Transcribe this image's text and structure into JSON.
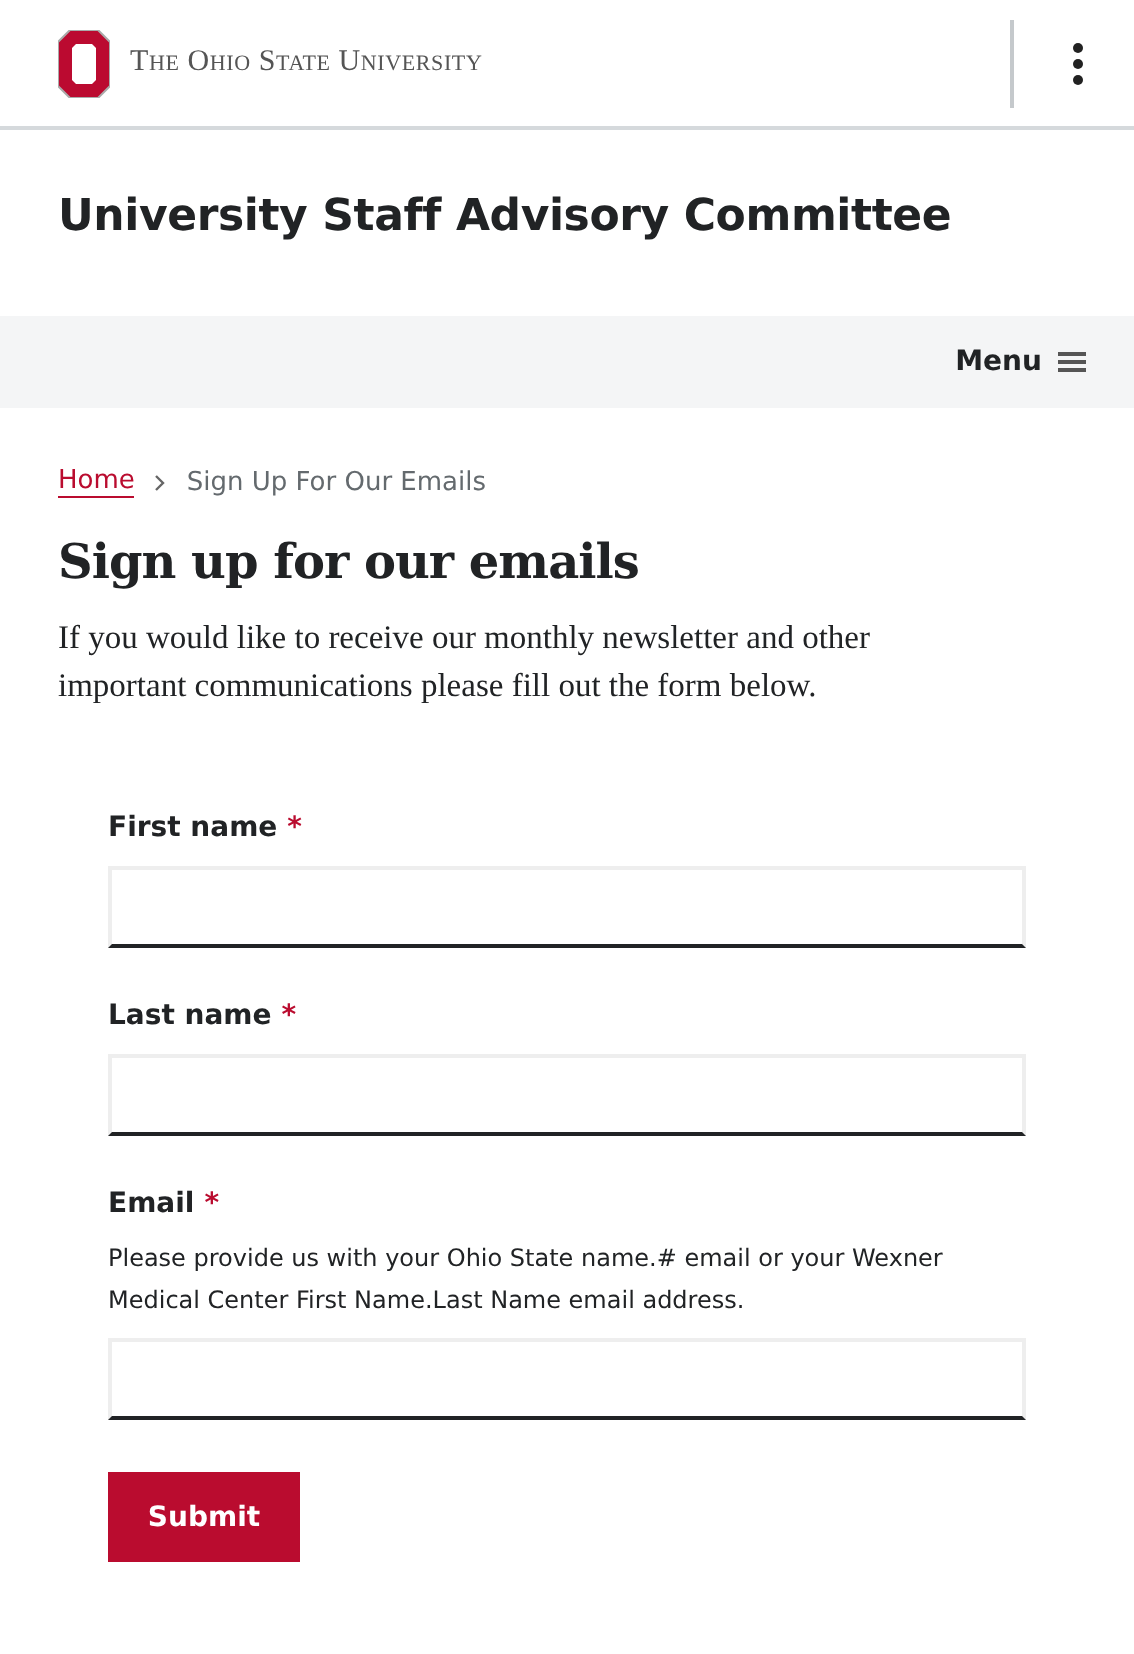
{
  "header": {
    "logo_text": "The Ohio State University"
  },
  "site_title": "University Staff Advisory Committee",
  "nav": {
    "menu_label": "Menu"
  },
  "breadcrumb": [
    {
      "label": "Home",
      "kind": "link"
    },
    {
      "label": "Sign Up For Our Emails",
      "kind": "current"
    }
  ],
  "page_title": "Sign up for our emails",
  "intro": "If you would like to receive our monthly newsletter and other important communications please fill out the form below.",
  "form": {
    "fields": [
      {
        "label": "First name",
        "required": true,
        "required_mark": "*"
      },
      {
        "label": "Last name",
        "required": true,
        "required_mark": "*"
      },
      {
        "label": "Email",
        "required": true,
        "required_mark": "*",
        "help": "Please provide us with your Ohio State name.# email or your Wexner Medical Center First Name.Last Name email address."
      }
    ],
    "submit": "Submit"
  }
}
